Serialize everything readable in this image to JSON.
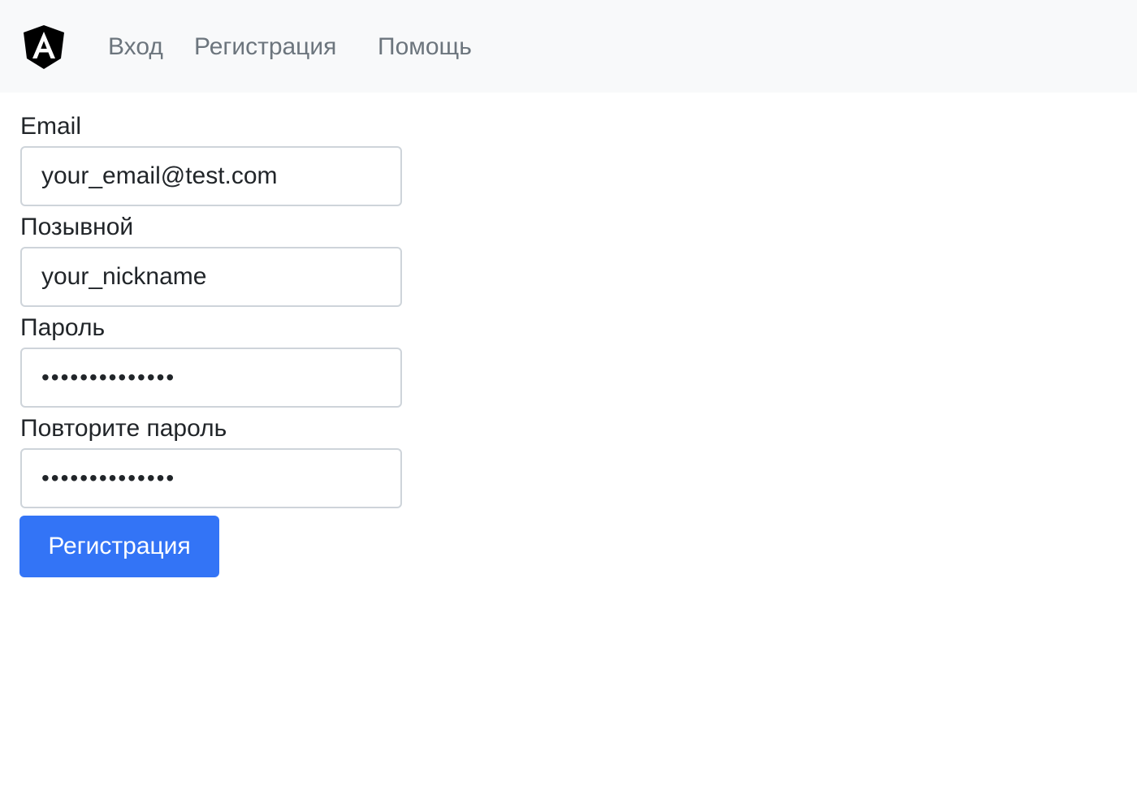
{
  "navbar": {
    "logo_icon": "angular-logo-icon",
    "links": [
      {
        "label": "Вход"
      },
      {
        "label": "Регистрация"
      },
      {
        "label": "Помощь"
      }
    ],
    "background": "#f8f9fa",
    "link_color": "#6c757d"
  },
  "form": {
    "email": {
      "label": "Email",
      "value": "your_email@test.com"
    },
    "nickname": {
      "label": "Позывной",
      "value": "your_nickname"
    },
    "password": {
      "label": "Пароль",
      "value": "••••••••••••••"
    },
    "password_repeat": {
      "label": "Повторите пароль",
      "value": "••••••••••••••"
    },
    "submit_label": "Регистрация",
    "submit_color": "#3374f6"
  }
}
